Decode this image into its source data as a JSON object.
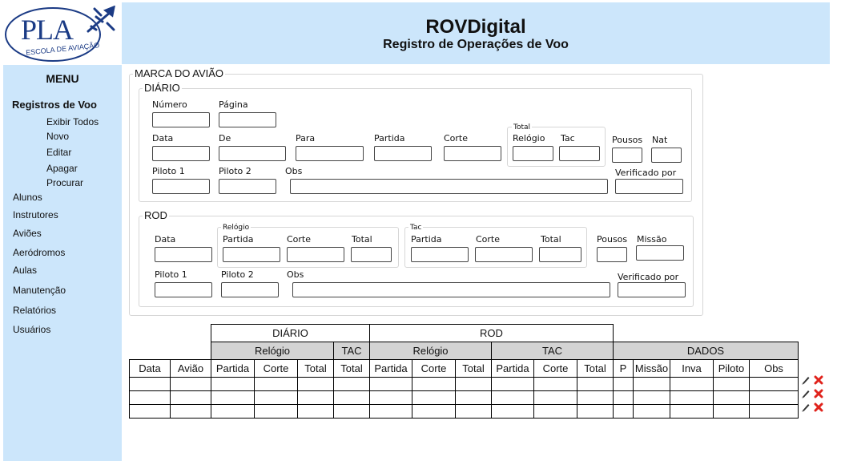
{
  "logo": {
    "text": "PLA",
    "subtitle": "ESCOLA DE AVIAÇÃO"
  },
  "header": {
    "title": "ROVDigital",
    "subtitle": "Registro de Operações de Voo"
  },
  "sidebar": {
    "title": "MENU",
    "section": "Registros de Voo",
    "subitems": [
      "Exibir Todos",
      "Novo",
      "Editar",
      "Apagar",
      "Procurar"
    ],
    "items": [
      "Alunos",
      "Instrutores",
      "Aviões",
      "Aeródromos",
      "Aulas",
      "Manutenção",
      "Relatórios",
      "Usuários"
    ]
  },
  "form": {
    "marca_label": "MARCA DO AVIÃO",
    "diario": {
      "legend": "DIÁRIO",
      "numero": "Número",
      "pagina": "Página",
      "data": "Data",
      "de": "De",
      "para": "Para",
      "partida": "Partida",
      "corte": "Corte",
      "total_group": "Total",
      "relogio": "Relógio",
      "tac": "Tac",
      "pousos": "Pousos",
      "nat": "Nat",
      "piloto1": "Piloto 1",
      "piloto2": "Piloto 2",
      "obs": "Obs",
      "verificado": "Verificado por"
    },
    "rod": {
      "legend": "ROD",
      "data": "Data",
      "relogio_group": "Relógio",
      "tac_group": "Tac",
      "partida": "Partida",
      "corte": "Corte",
      "total": "Total",
      "tac_partida": "Partida",
      "tac_corte": "Corte",
      "tac_total": "Total",
      "pousos": "Pousos",
      "missao": "Missão",
      "piloto1": "Piloto 1",
      "piloto2": "Piloto 2",
      "obs": "Obs",
      "verificado": "Verificado por"
    }
  },
  "table": {
    "group_diario": "DIÁRIO",
    "group_rod": "ROD",
    "sub_relogio_diario": "Relógio",
    "sub_tac_diario": "TAC",
    "sub_relogio_rod": "Relógio",
    "sub_tac_rod": "TAC",
    "sub_dados": "DADOS",
    "columns": [
      "Data",
      "Avião",
      "Partida",
      "Corte",
      "Total",
      "Total",
      "Partida",
      "Corte",
      "Total",
      "Partida",
      "Corte",
      "Total",
      "P",
      "Missão",
      "Inva",
      "Piloto",
      "Obs"
    ],
    "rows": [
      [
        "",
        "",
        "",
        "",
        "",
        "",
        "",
        "",
        "",
        "",
        "",
        "",
        "",
        "",
        "",
        "",
        ""
      ],
      [
        "",
        "",
        "",
        "",
        "",
        "",
        "",
        "",
        "",
        "",
        "",
        "",
        "",
        "",
        "",
        "",
        ""
      ],
      [
        "",
        "",
        "",
        "",
        "",
        "",
        "",
        "",
        "",
        "",
        "",
        "",
        "",
        "",
        "",
        "",
        ""
      ]
    ]
  },
  "colors": {
    "panel": "#cce6fb",
    "header_gray": "#d3d3d3",
    "logo_blue": "#1b3b85",
    "delete_red": "#e0231c"
  },
  "icons": {
    "edit": "pencil-icon",
    "delete": "delete-x-icon",
    "logo": "airplane-icon"
  }
}
